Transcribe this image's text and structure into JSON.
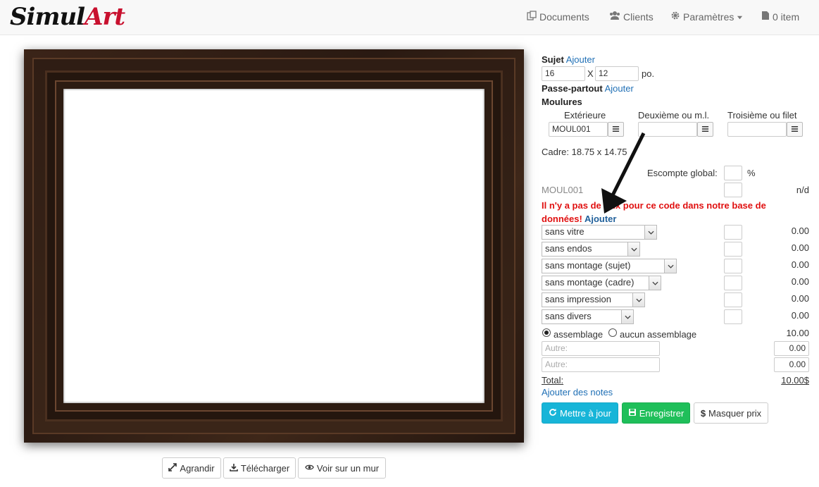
{
  "brand": {
    "part1": "Simul",
    "part2": "Art"
  },
  "nav": {
    "documents": "Documents",
    "clients": "Clients",
    "parametres": "Paramètres",
    "cart": "0 item"
  },
  "preview_buttons": {
    "agrandir": "Agrandir",
    "telecharger": "Télécharger",
    "voir_mur": "Voir sur un mur"
  },
  "form": {
    "sujet_label": "Sujet",
    "sujet_add": "Ajouter",
    "width": "16",
    "times": "X",
    "height": "12",
    "unit": "po.",
    "passe_label": "Passe-partout",
    "passe_add": "Ajouter",
    "moulures_label": "Moulures",
    "col_ext": "Extérieure",
    "col_deux": "Deuxième ou m.l.",
    "col_trois": "Troisième ou filet",
    "ext_value": "MOUL001",
    "deux_value": "",
    "trois_value": "",
    "cadre": "Cadre: 18.75 x 14.75",
    "escompte_label": "Escompte global:",
    "escompte_pct": "%",
    "moul_code": "MOUL001",
    "moul_price": "n/d",
    "warning": "Il n'y a pas de prix pour ce code dans notre base de données!",
    "warning_add": "Ajouter",
    "options": [
      {
        "label": "sans vitre",
        "price": "0.00"
      },
      {
        "label": "sans endos",
        "price": "0.00"
      },
      {
        "label": "sans montage (sujet)",
        "price": "0.00"
      },
      {
        "label": "sans montage (cadre)",
        "price": "0.00"
      },
      {
        "label": "sans impression",
        "price": "0.00"
      },
      {
        "label": "sans divers",
        "price": "0.00"
      }
    ],
    "assemblage": "assemblage",
    "aucun_assemblage": "aucun assemblage",
    "assemblage_price": "10.00",
    "autre1_placeholder": "Autre:",
    "autre1_value": "0.00",
    "autre2_placeholder": "Autre:",
    "autre2_value": "0.00",
    "total_label": "Total:",
    "total_value": "10.00$",
    "notes_link": "Ajouter des notes"
  },
  "actions": {
    "update": "Mettre à jour",
    "save": "Enregistrer",
    "hide_price": "Masquer prix"
  },
  "colors": {
    "brand_dark": "#111111",
    "brand_red": "#c8102e",
    "link": "#1f6fb5",
    "info": "#17b5d8",
    "success": "#1fbf5a",
    "warning": "#e01010"
  }
}
